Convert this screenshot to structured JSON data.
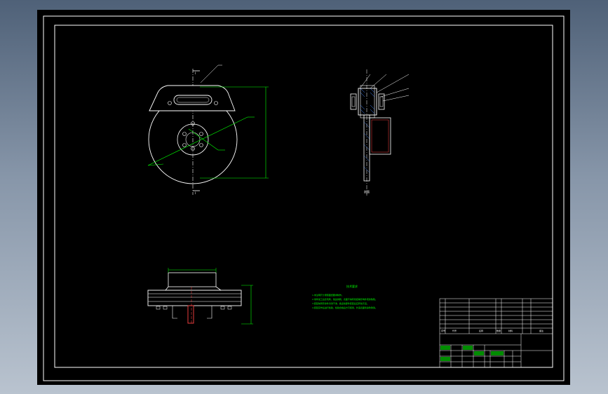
{
  "colors": {
    "background_top": "#4f6178",
    "background_bottom": "#b9c3cf",
    "sheet": "#000000",
    "line": "#ffffff",
    "dimension": "#00ff00",
    "note_text": "#00ff00",
    "highlight": "#ff0000",
    "hatch": "#4488ff"
  },
  "notes": {
    "heading": "技术要求",
    "lines": [
      "1.未注明尺寸按照图纸要求制作。",
      "2.零件加工后去毛刺，锐边倒钝，表面不得有划痕等影响外观的缺陷。",
      "3.装配前所有零件清洗干净，各运动部件装配后应转动灵活。",
      "4.装配完毕后进行检验，检验合格后方可使用，外露表面喷涂防锈漆。"
    ]
  },
  "section_label": "剖面",
  "title_block": {
    "header_cells": [
      "序号",
      "代号",
      "名称",
      "数量",
      "材料",
      "备注"
    ]
  }
}
